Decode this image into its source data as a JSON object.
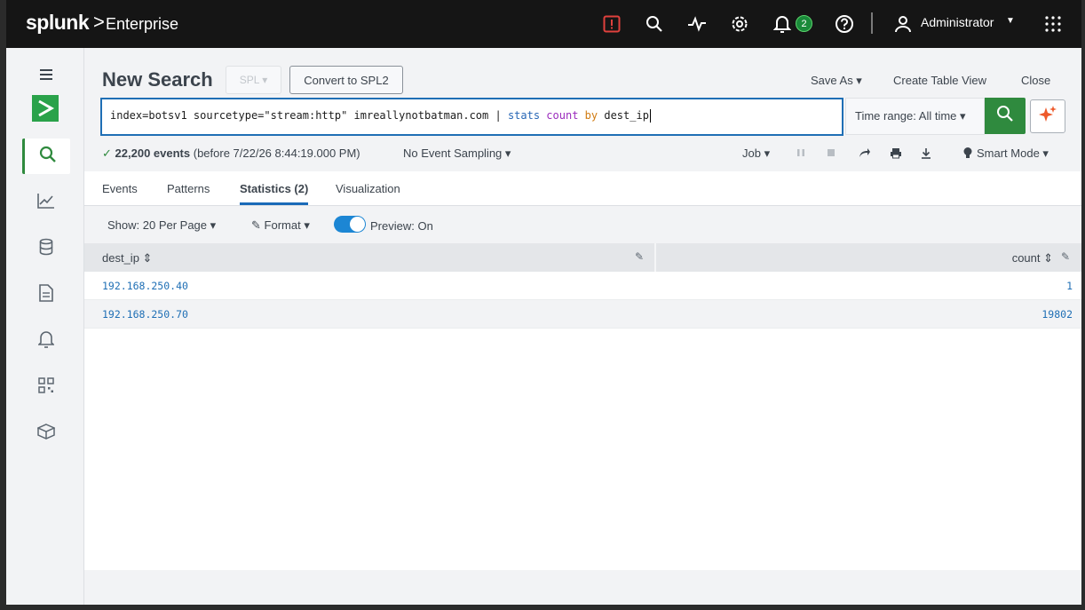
{
  "topbar": {
    "logo": "splunk",
    "logo_gt": ">",
    "product": "Enterprise",
    "icons": [
      "alert-icon",
      "search-icon",
      "activity-icon",
      "gear-icon",
      "bell-icon",
      "help-icon",
      "user-icon",
      "apps-grid-icon"
    ],
    "notification_count": "2",
    "user": "Administrator"
  },
  "sidebar": {
    "items": [
      "menu-icon",
      "app-logo-icon",
      "search-icon",
      "chart-icon",
      "database-icon",
      "document-icon",
      "bell-icon",
      "grid-icon",
      "box-icon"
    ]
  },
  "header": {
    "title": "New Search",
    "spl_label": "SPL ▾",
    "convert_label": "Convert to SPL2",
    "save_as": "Save As ▾",
    "create_table": "Create Table View",
    "close": "Close"
  },
  "search": {
    "query_base": "index=botsv1 sourcetype=\"stream:http\" imreallynotbatman.com | ",
    "kw_stats": "stats",
    "kw_count": "count",
    "kw_by": "by",
    "field": "dest_ip",
    "time_range": "Time range: All time ▾",
    "accent": "#2f8a3e"
  },
  "status": {
    "check": "✓",
    "events": "22,200 events",
    "before": "(before 7/22/26 8:44:19.000 PM)",
    "sampling": "No Event Sampling ▾",
    "job": "Job ▾",
    "smart_mode": "Smart Mode ▾"
  },
  "tabs": [
    {
      "label": "Events"
    },
    {
      "label": "Patterns"
    },
    {
      "label": "Statistics (2)"
    },
    {
      "label": "Visualization"
    }
  ],
  "controls": {
    "show": "Show: 20 Per Page ▾",
    "format": "Format ▾",
    "preview": "Preview: On"
  },
  "table": {
    "columns": [
      "dest_ip ⇕",
      "count ⇕"
    ],
    "rows": [
      {
        "dest_ip": "192.168.250.40",
        "count": "1"
      },
      {
        "dest_ip": "192.168.250.70",
        "count": "19802"
      }
    ]
  }
}
